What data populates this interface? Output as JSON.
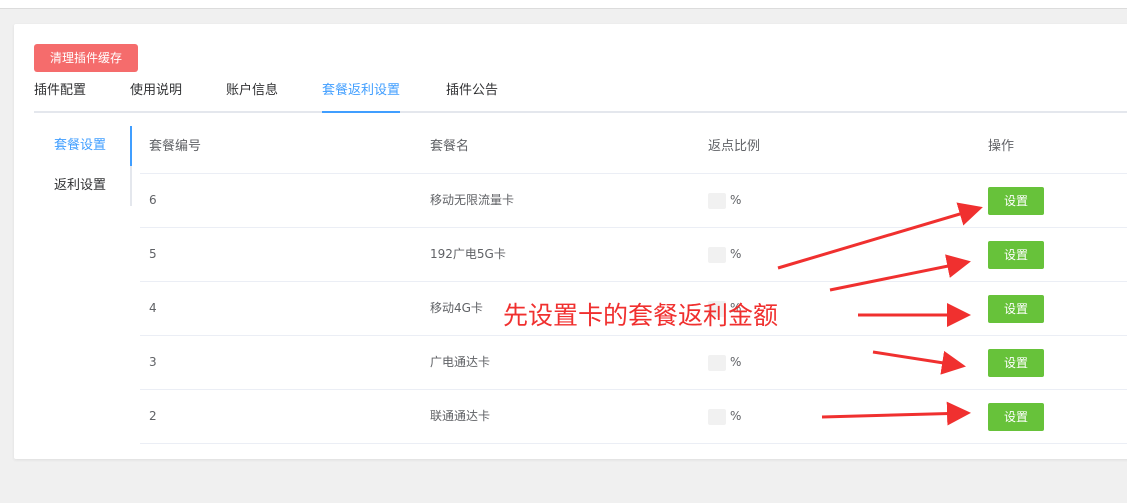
{
  "toolbar": {
    "clear_cache_label": "清理插件缓存"
  },
  "tabs": [
    {
      "label": "插件配置"
    },
    {
      "label": "使用说明"
    },
    {
      "label": "账户信息"
    },
    {
      "label": "套餐返利设置",
      "active": true
    },
    {
      "label": "插件公告"
    }
  ],
  "side_menu": [
    {
      "label": "套餐设置",
      "active": true
    },
    {
      "label": "返利设置"
    }
  ],
  "table": {
    "headers": [
      "套餐编号",
      "套餐名",
      "返点比例",
      "操作"
    ],
    "rows": [
      {
        "id": "6",
        "name": "移动无限流量卡",
        "ratio_unit": "%",
        "action": "设置"
      },
      {
        "id": "5",
        "name": "192广电5G卡",
        "ratio_unit": "%",
        "action": "设置"
      },
      {
        "id": "4",
        "name": "移动4G卡",
        "ratio_unit": "%",
        "action": "设置"
      },
      {
        "id": "3",
        "name": "广电通达卡",
        "ratio_unit": "%",
        "action": "设置"
      },
      {
        "id": "2",
        "name": "联通通达卡",
        "ratio_unit": "%",
        "action": "设置"
      }
    ]
  },
  "annotation": {
    "text": "先设置卡的套餐返利金额"
  },
  "colors": {
    "accent": "#409eff",
    "danger": "#f56c6c",
    "success": "#67c23a",
    "annotation": "#f0302f"
  }
}
